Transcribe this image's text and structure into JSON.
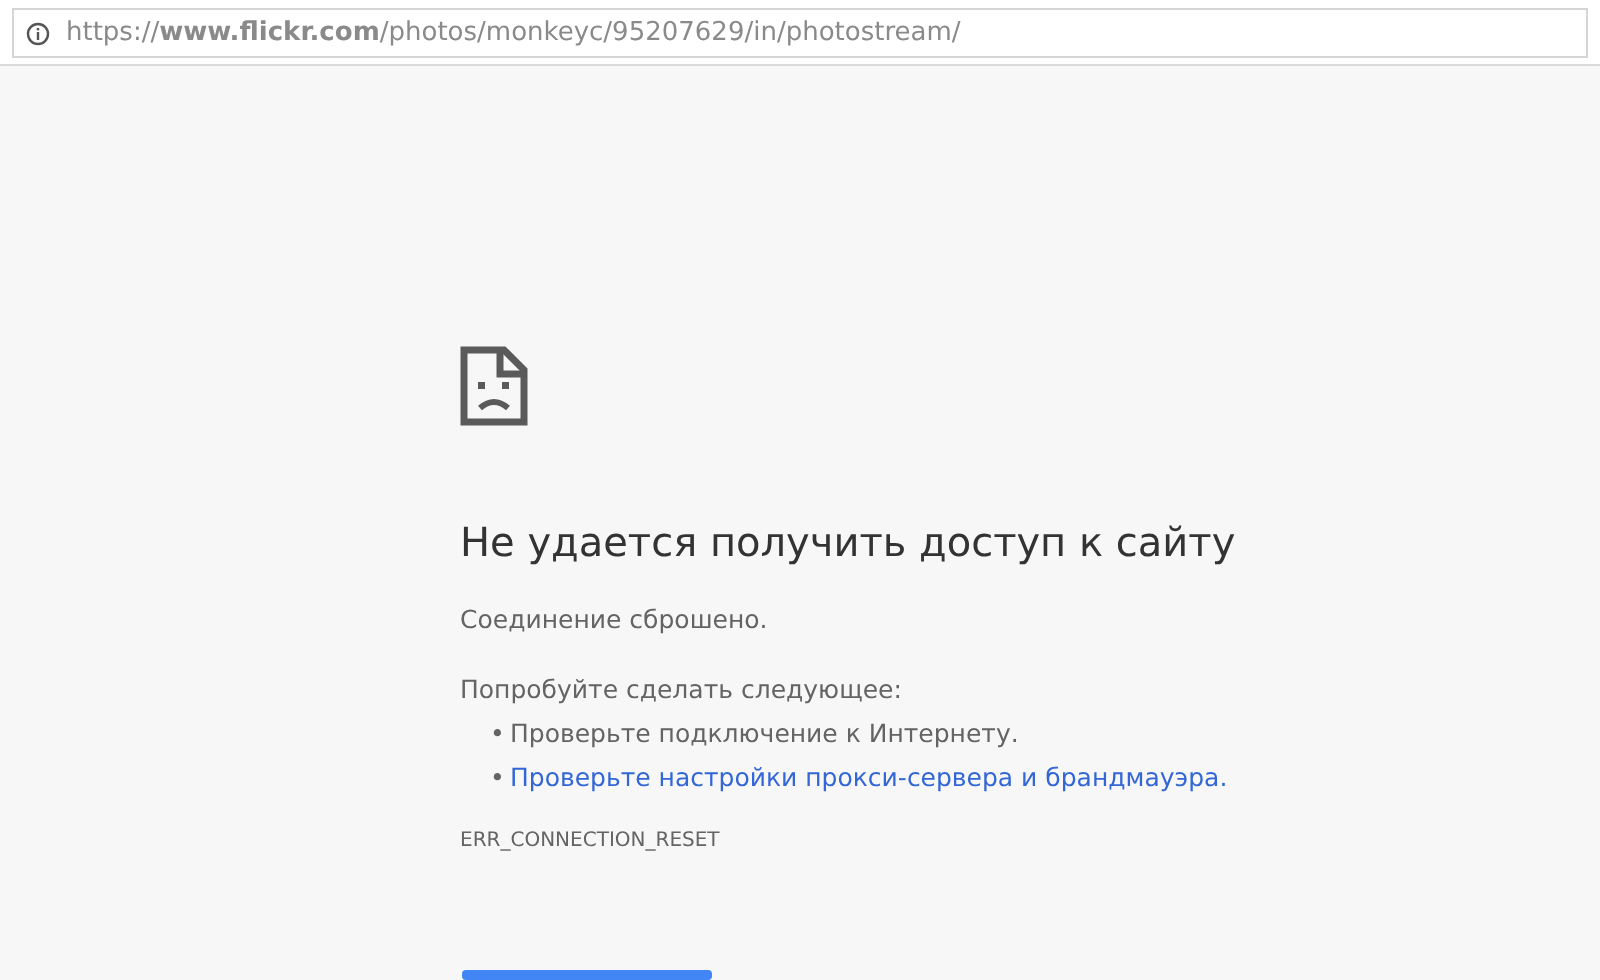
{
  "address_bar": {
    "url": "https://**www.flickr.com**/photos/monkeyc/95207629/in/photostream/"
  },
  "error": {
    "title": "Не удается получить доступ к сайту",
    "message": "Соединение сброшено.",
    "suggestions_heading": "Попробуйте сделать следующее:",
    "suggestions": [
      {
        "kind": "text",
        "bullet": "•",
        "text": "Проверьте подключение к Интернету."
      },
      {
        "kind": "link",
        "bullet": "•",
        "text": "Проверьте настройки прокси-сервера и брандмауэра."
      }
    ],
    "code": "ERR_CONNECTION_RESET"
  }
}
